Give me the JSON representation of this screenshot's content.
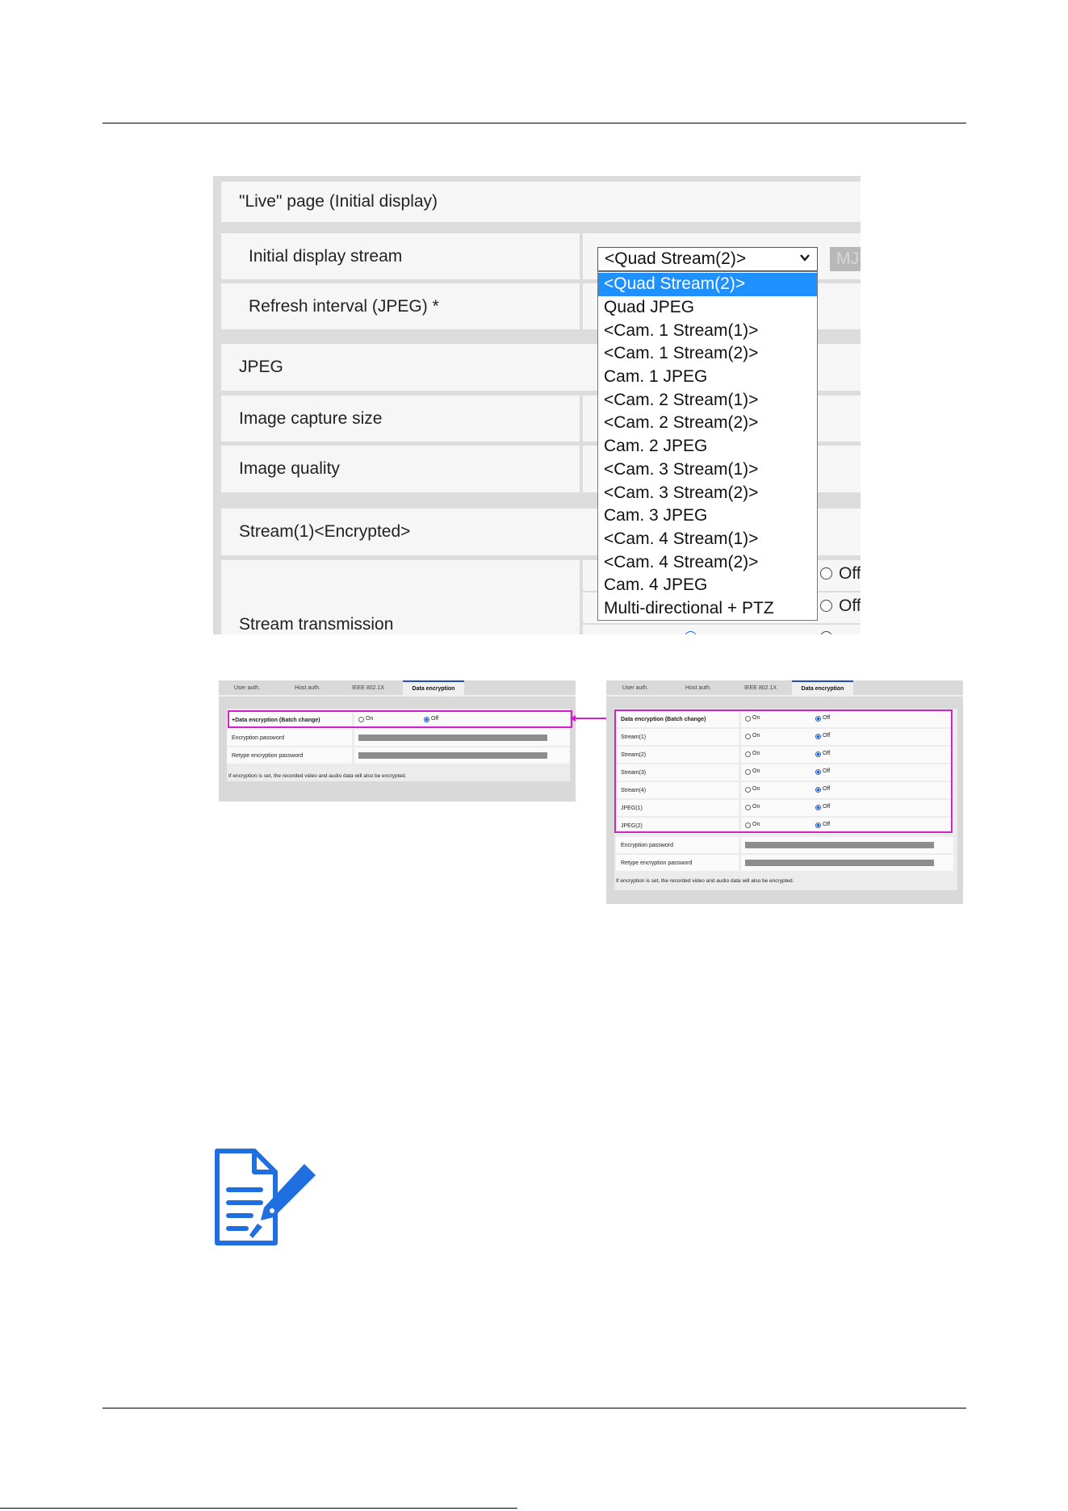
{
  "live_panel": {
    "section_live": "\"Live\" page (Initial display)",
    "initial_display_stream_label": "Initial display stream",
    "refresh_interval_label": "Refresh interval (JPEG) *",
    "section_jpeg": "JPEG",
    "image_capture_size_label": "Image capture size",
    "image_quality_label": "Image quality",
    "section_stream1": "Stream(1)<Encrypted>",
    "stream_transmission_label": "Stream transmission",
    "selected_value": "<Quad Stream(2)>",
    "side_button": "MJ",
    "off_label_1": "Off",
    "off_label_2": "Off",
    "options": [
      "<Quad Stream(2)>",
      "Quad JPEG",
      "<Cam. 1 Stream(1)>",
      "<Cam. 1 Stream(2)>",
      "Cam. 1 JPEG",
      "<Cam. 2 Stream(1)>",
      "<Cam. 2 Stream(2)>",
      "Cam. 2 JPEG",
      "<Cam. 3 Stream(1)>",
      "<Cam. 3 Stream(2)>",
      "Cam. 3 JPEG",
      "<Cam. 4 Stream(1)>",
      "<Cam. 4 Stream(2)>",
      "Cam. 4 JPEG",
      "Multi-directional + PTZ"
    ]
  },
  "tabs": {
    "user_auth": "User auth.",
    "host_auth": "Host auth.",
    "ieee": "IEEE 802.1X",
    "data_encryption": "Data encryption"
  },
  "left_panel": {
    "batch_label": "+Data encryption (Batch change)",
    "on": "On",
    "off": "Off",
    "encryption_password": "Encryption password",
    "retype_password": "Retype encryption password",
    "note": "If encryption is set, the recorded video and audio data will also be encrypted."
  },
  "right_panel": {
    "batch_label": "Data encryption (Batch change)",
    "rows": [
      {
        "label": "Stream(1)",
        "on": "On",
        "off": "Off"
      },
      {
        "label": "Stream(2)",
        "on": "On",
        "off": "Off"
      },
      {
        "label": "Stream(3)",
        "on": "On",
        "off": "Off"
      },
      {
        "label": "Stream(4)",
        "on": "On",
        "off": "Off"
      },
      {
        "label": "JPEG(1)",
        "on": "On",
        "off": "Off"
      },
      {
        "label": "JPEG(2)",
        "on": "On",
        "off": "Off"
      }
    ],
    "on": "On",
    "off": "Off",
    "encryption_password": "Encryption password",
    "retype_password": "Retype encryption password",
    "note": "If encryption is set, the recorded video and audio data will also be encrypted."
  },
  "colors": {
    "highlight": "#d21fd2",
    "selected_option": "#1e90ff",
    "note_icon": "#1f6fe0"
  },
  "icons": {
    "note": "document-with-pen-icon"
  }
}
